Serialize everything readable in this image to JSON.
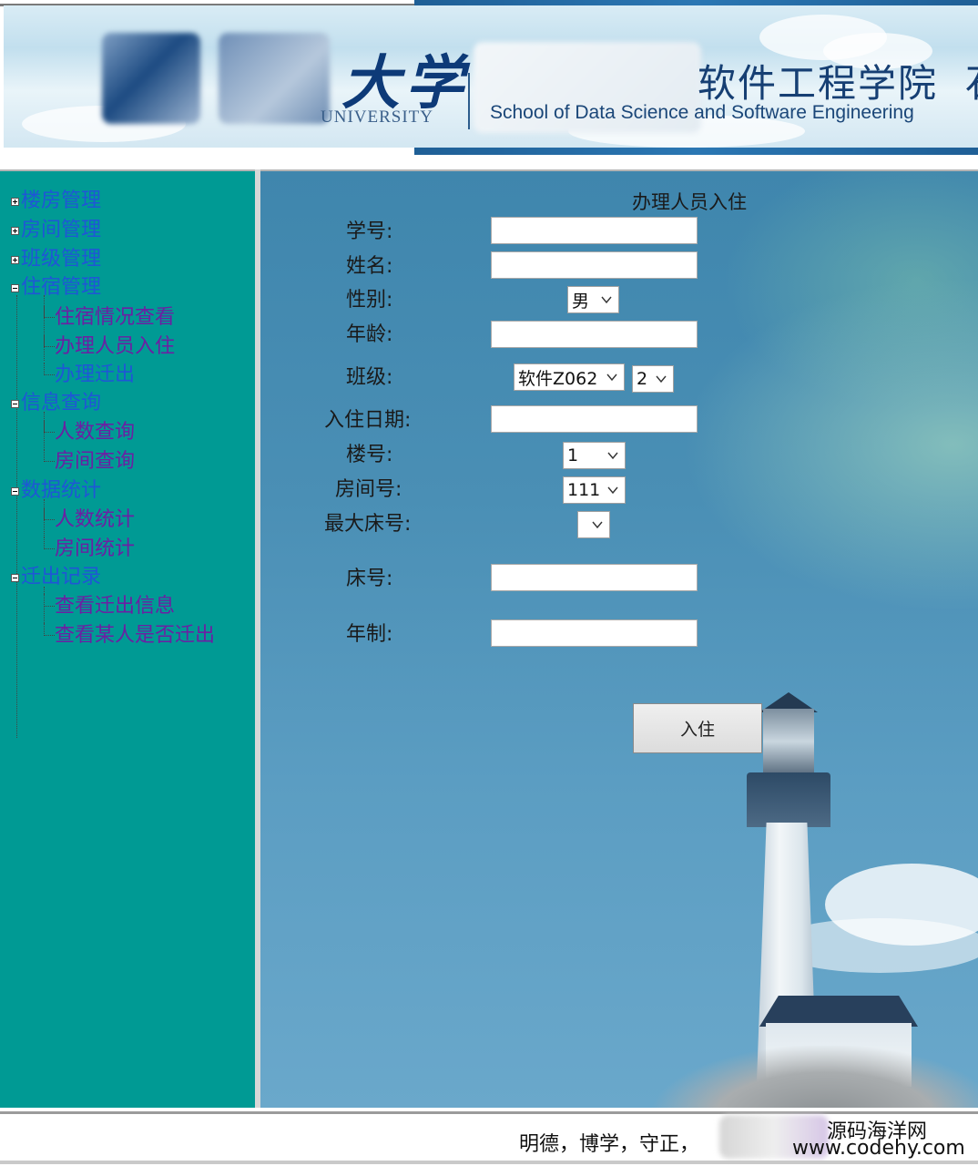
{
  "header": {
    "university_cn": "大学",
    "university_en": "UNIVERSITY",
    "school_cn": "软件工程学院",
    "school_en": "School of Data Science and Software Engineering",
    "school_extra": "石"
  },
  "sidebar": {
    "groups": [
      {
        "label": "楼房管理",
        "expanded": false,
        "children": []
      },
      {
        "label": "房间管理",
        "expanded": false,
        "children": []
      },
      {
        "label": "班级管理",
        "expanded": false,
        "children": []
      },
      {
        "label": "住宿管理",
        "expanded": true,
        "children": [
          "住宿情况查看",
          "办理人员入住",
          "办理迁出"
        ]
      },
      {
        "label": "信息查询",
        "expanded": true,
        "children": [
          "人数查询",
          "房间查询"
        ]
      },
      {
        "label": "数据统计",
        "expanded": true,
        "children": [
          "人数统计",
          "房间统计"
        ]
      },
      {
        "label": "迁出记录",
        "expanded": true,
        "children": [
          "查看迁出信息",
          "查看某人是否迁出"
        ]
      }
    ]
  },
  "form": {
    "title": "办理人员入住",
    "labels": {
      "student_id": "学号:",
      "name": "姓名:",
      "gender": "性别:",
      "age": "年龄:",
      "class": "班级:",
      "checkin_date": "入住日期:",
      "building": "楼号:",
      "room": "房间号:",
      "max_bed": "最大床号:",
      "bed": "床号:",
      "years": "年制:"
    },
    "values": {
      "student_id": "",
      "name": "",
      "age": "",
      "checkin_date": "",
      "bed": "",
      "years": ""
    },
    "selects": {
      "gender": "男",
      "class_major": "软件Z062",
      "class_no": "2",
      "building": "1",
      "room": "111",
      "max_bed": ""
    },
    "submit_label": "入住"
  },
  "footer": {
    "motto": "明德，博学，守正，",
    "watermark_cn": "源码海洋网",
    "watermark_url": "www.codehy.com"
  }
}
